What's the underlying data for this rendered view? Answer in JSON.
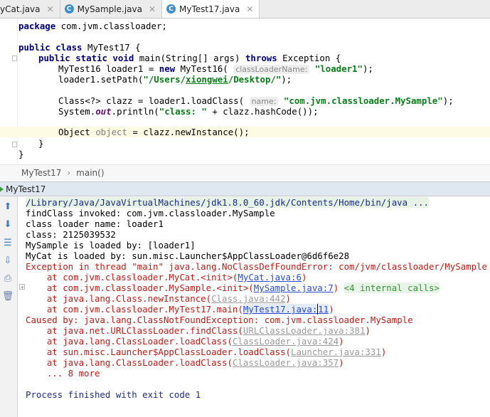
{
  "tabs": [
    {
      "label": "yCat.java",
      "icon": "java-class-icon",
      "active": false
    },
    {
      "label": "MySample.java",
      "icon": "java-class-icon",
      "active": false
    },
    {
      "label": "MyTest17.java",
      "icon": "java-class-icon",
      "active": true
    }
  ],
  "code": {
    "l1_kw": "package",
    "l1_rest": " com.jvm.classloader;",
    "l3_kw": "public class",
    "l3_rest": " MyTest17 {",
    "l4_kw1": "public static void",
    "l4_mid": " main(String[] args) ",
    "l4_kw2": "throws",
    "l4_rest": " Exception {",
    "l5_a": "MyTest16 loader1 = ",
    "l5_kw": "new",
    "l5_b": " MyTest16( ",
    "l5_hint": "classLoaderName:",
    "l5_str": " \"loader1\"",
    "l5_end": ");",
    "l6_a": "loader1.setPath(",
    "l6_str_pre": "\"/Users/",
    "l6_str_u": "xiongwei",
    "l6_str_post": "/Desktop/\"",
    "l6_end": ");",
    "l8_a": "Class<?> clazz = loader1.loadClass( ",
    "l8_hint": "name:",
    "l8_str": " \"com.jvm.classloader.MySample\"",
    "l8_end": ");",
    "l9_a": "System.",
    "l9_field": "out",
    "l9_b": ".println(",
    "l9_str": "\"class: \"",
    "l9_end": " + clazz.hashCode());",
    "l11_a": "Object ",
    "l11_var": "object",
    "l11_end": " = clazz.newInstance();",
    "l12": "}",
    "l13": "}"
  },
  "breadcrumb": {
    "class": "MyTest17",
    "method": "main()"
  },
  "run": {
    "title": "MyTest17"
  },
  "console": {
    "cmd": "/Library/Java/JavaVirtualMachines/jdk1.8.0_60.jdk/Contents/Home/bin/java ...",
    "o1": "findClass invoked: com.jvm.classloader.MySample",
    "o2": "class loader name: loader1",
    "o3": "class: 2125039532",
    "o4": "MySample is loaded by: [loader1]",
    "o5": "MyCat is loaded by: sun.misc.Launcher$AppClassLoader@6d6f6e28",
    "e1": "Exception in thread \"main\" java.lang.NoClassDefFoundError: com/jvm/classloader/MySample",
    "s1_a": "    at com.jvm.classloader.MyCat.<init>(",
    "s1_link": "MyCat.java:6",
    "s1_end": ")",
    "s2_a": "    at com.jvm.classloader.MySample.<init>(",
    "s2_link": "MySample.java:7",
    "s2_end": ") ",
    "s2_internal": "<4 internal calls>",
    "s3_a": "    at java.lang.Class.newInstance(",
    "s3_link": "Class.java:442",
    "s3_end": ")",
    "s4_a": "    at com.jvm.classloader.MyTest17.main(",
    "s4_link_a": "MyTest17.java:",
    "s4_link_b": "11",
    "s4_end": ")",
    "c1": "Caused by: java.lang.ClassNotFoundException: com.jvm.classloader.MySample",
    "c2_a": "    at java.net.URLClassLoader.findClass(",
    "c2_link": "URLClassLoader.java:381",
    "c2_end": ")",
    "c3_a": "    at java.lang.ClassLoader.loadClass(",
    "c3_link": "ClassLoader.java:424",
    "c3_end": ")",
    "c4_a": "    at sun.misc.Launcher$AppClassLoader.loadClass(",
    "c4_link": "Launcher.java:331",
    "c4_end": ")",
    "c5_a": "    at java.lang.ClassLoader.loadClass(",
    "c5_link": "ClassLoader.java:357",
    "c5_end": ")",
    "c6": "    ... 8 more",
    "exit": "Process finished with exit code 1"
  }
}
